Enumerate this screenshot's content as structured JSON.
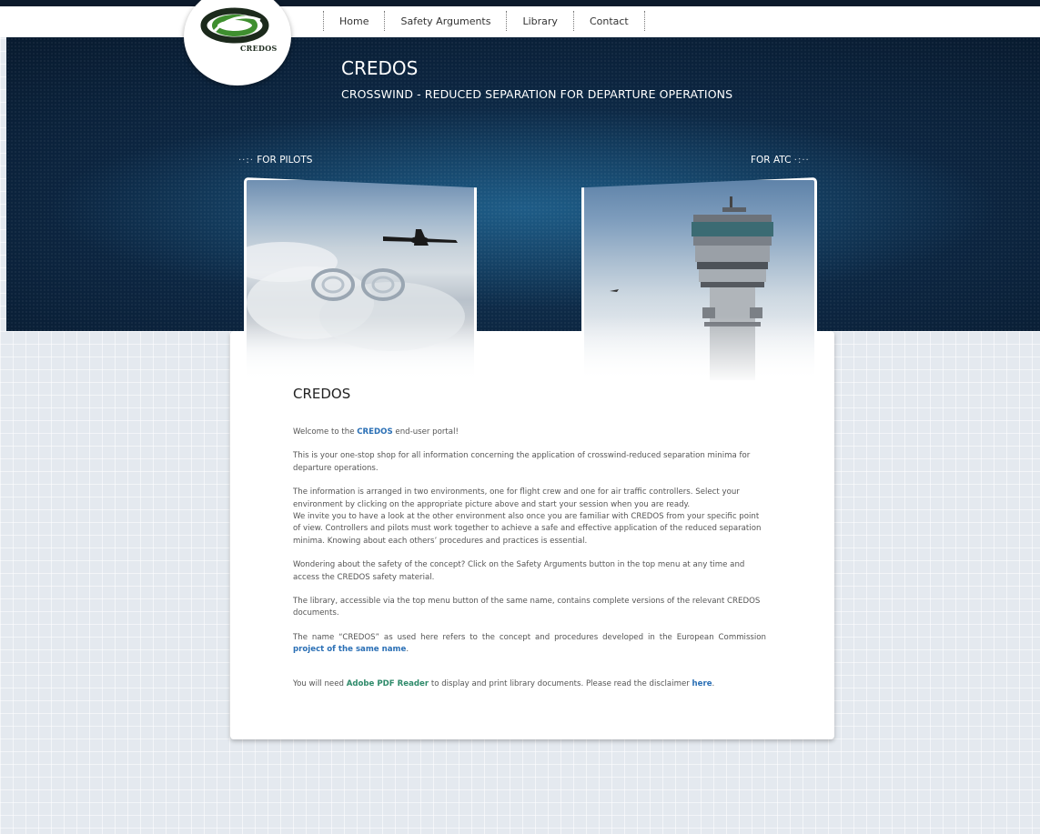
{
  "nav": {
    "items": [
      "Home",
      "Safety Arguments",
      "Library",
      "Contact"
    ]
  },
  "logo": {
    "text": "CREDOS"
  },
  "header": {
    "title": "CREDOS",
    "subtitle": "CROSSWIND - REDUCED SEPARATION FOR DEPARTURE OPERATIONS"
  },
  "environments": {
    "pilots_label": "FOR PILOTS",
    "atc_label": "FOR ATC"
  },
  "content": {
    "heading": "CREDOS",
    "p1_before": "Welcome to the ",
    "p1_link": "CREDOS",
    "p1_after": " end-user portal!",
    "p2": "This is your one-stop shop for all information concerning the application of crosswind-reduced separation minima for departure operations.",
    "p3a": "The information is arranged in two environments, one for flight crew and one for air traffic controllers. Select your environment by clicking on the appropriate picture above and start your session when you are ready.",
    "p3b": "We invite you to have a look at the other environment also once you are familiar with CREDOS from your specific point of view.  Controllers and pilots must work together to achieve a safe and effective application of the reduced separation minima. Knowing about each others’ procedures and practices is essential.",
    "p4": "Wondering about the safety of the concept? Click on the Safety Arguments button in the top menu at any time and access the CREDOS safety material.",
    "p5": "The library, accessible via the top menu button of the same name, contains complete versions of the relevant CREDOS documents.",
    "p6_before": "The name “CREDOS” as used here refers to the concept and procedures developed in the European Commission ",
    "p6_link": "project of the same name",
    "p6_after": ".",
    "p7_before": "You will need ",
    "p7_link": "Adobe PDF Reader",
    "p7_middle": " to display and print library documents. Please read the disclaimer ",
    "p7_link2": "here",
    "p7_after": "."
  },
  "colors": {
    "hero_dark": "#0c2540",
    "link_blue": "#2a6fb5",
    "link_green": "#2e8a6a",
    "logo_green": "#3f8f2f"
  },
  "icons": {
    "logo": "credos-swirl-logo",
    "pilots_marker": "dots-arrow-icon",
    "atc_marker": "dots-arrow-icon"
  }
}
